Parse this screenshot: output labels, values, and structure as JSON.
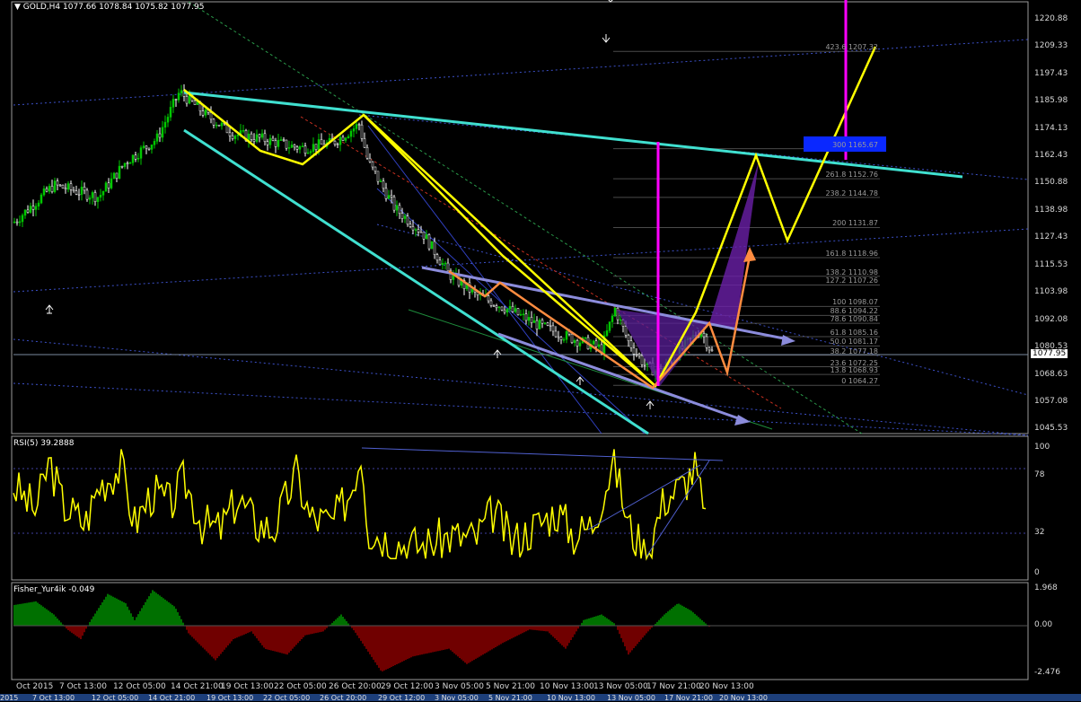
{
  "header": {
    "symbol": "GOLD,H4",
    "ohlc": "1077.66 1078.84 1075.82 1077.95"
  },
  "current_price": "1077.95",
  "price_axis": [
    "1220.88",
    "1209.33",
    "1197.43",
    "1185.98",
    "1174.13",
    "1162.43",
    "1150.88",
    "1138.98",
    "1127.43",
    "1115.53",
    "1103.98",
    "1092.08",
    "1080.53",
    "1068.63",
    "1057.08",
    "1045.53"
  ],
  "fib_levels": [
    {
      "ratio": "423.6",
      "price": "1207.32"
    },
    {
      "ratio": "300",
      "price": "1165.67"
    },
    {
      "ratio": "261.8",
      "price": "1152.76"
    },
    {
      "ratio": "238.2",
      "price": "1144.78"
    },
    {
      "ratio": "200",
      "price": "1131.87"
    },
    {
      "ratio": "161.8",
      "price": "1118.96"
    },
    {
      "ratio": "138.2",
      "price": "1110.98"
    },
    {
      "ratio": "127.2",
      "price": "1107.26"
    },
    {
      "ratio": "100",
      "price": "1098.07"
    },
    {
      "ratio": "88.6",
      "price": "1094.22"
    },
    {
      "ratio": "78.6",
      "price": "1090.84"
    },
    {
      "ratio": "61.8",
      "price": "1085.16"
    },
    {
      "ratio": "50.0",
      "price": "1081.17"
    },
    {
      "ratio": "38.2",
      "price": "1077.18"
    },
    {
      "ratio": "23.6",
      "price": "1072.25"
    },
    {
      "ratio": "13.8",
      "price": "1068.93"
    },
    {
      "ratio": "0",
      "price": "1064.27"
    }
  ],
  "rsi": {
    "title": "RSI(5) 39.2888",
    "axis": [
      "100",
      "78",
      "32",
      "0"
    ]
  },
  "fisher": {
    "title": "Fisher_Yur4ik -0.049",
    "axis": [
      "1.968",
      "0.00",
      "-2.476"
    ]
  },
  "x_axis": [
    "Oct 2015",
    "7 Oct 13:00",
    "12 Oct 05:00",
    "14 Oct 21:00",
    "19 Oct 13:00",
    "22 Oct 05:00",
    "26 Oct 20:00",
    "29 Oct 12:00",
    "3 Nov 05:00",
    "5 Nov 21:00",
    "10 Nov 13:00",
    "13 Nov 05:00",
    "17 Nov 21:00",
    "20 Nov 13:00"
  ],
  "taskbar": [
    "2015",
    "7 Oct 13:00",
    "12 Oct 05:00",
    "14 Oct 21:00",
    "19 Oct 13:00",
    "22 Oct 05:00",
    "26 Oct 20:00",
    "29 Oct 12:00",
    "3 Nov 05:00",
    "5 Nov 21:00",
    "10 Nov 13:00",
    "13 Nov 05:00",
    "17 Nov 21:00",
    "20 Nov 13:00"
  ],
  "colors": {
    "bull_candle": "#00c800",
    "bear_candle": "#ffffff",
    "yellow": "#ffff00",
    "cyan": "#40e0d0",
    "magenta": "#ff00ff",
    "orange": "#ff8c40",
    "lavender": "#8c8cdc",
    "rsi": "#ffff00",
    "fisher_pos": "#00e000",
    "fisher_neg": "#e00000",
    "blue_box": "#0a28ff",
    "purple": "#6a1fa8"
  },
  "chart_data": {
    "type": "line",
    "title": "GOLD,H4",
    "ylim": [
      1045.53,
      1220.88
    ],
    "x": [
      "Oct 2015",
      "7 Oct 13:00",
      "12 Oct 05:00",
      "14 Oct 21:00",
      "19 Oct 13:00",
      "22 Oct 05:00",
      "26 Oct 20:00",
      "29 Oct 12:00",
      "3 Nov 05:00",
      "5 Nov 21:00",
      "10 Nov 13:00",
      "13 Nov 05:00",
      "17 Nov 21:00",
      "20 Nov 13:00"
    ],
    "series": [
      {
        "values": [
          1134,
          1156,
          1178,
          1189,
          1168,
          1163,
          1166,
          1142,
          1112,
          1098,
          1085,
          1086,
          1068,
          1078
        ]
      }
    ],
    "rsi_values": [
      80,
      62,
      45,
      70,
      55,
      40,
      90,
      35,
      30,
      45,
      40,
      42,
      20,
      39.29
    ],
    "fisher_values": [
      1.2,
      0.8,
      1.4,
      -0.6,
      -1.0,
      -0.8,
      0.5,
      -2.3,
      -1.5,
      -0.9,
      -0.5,
      0.7,
      -0.4,
      -0.049
    ]
  }
}
